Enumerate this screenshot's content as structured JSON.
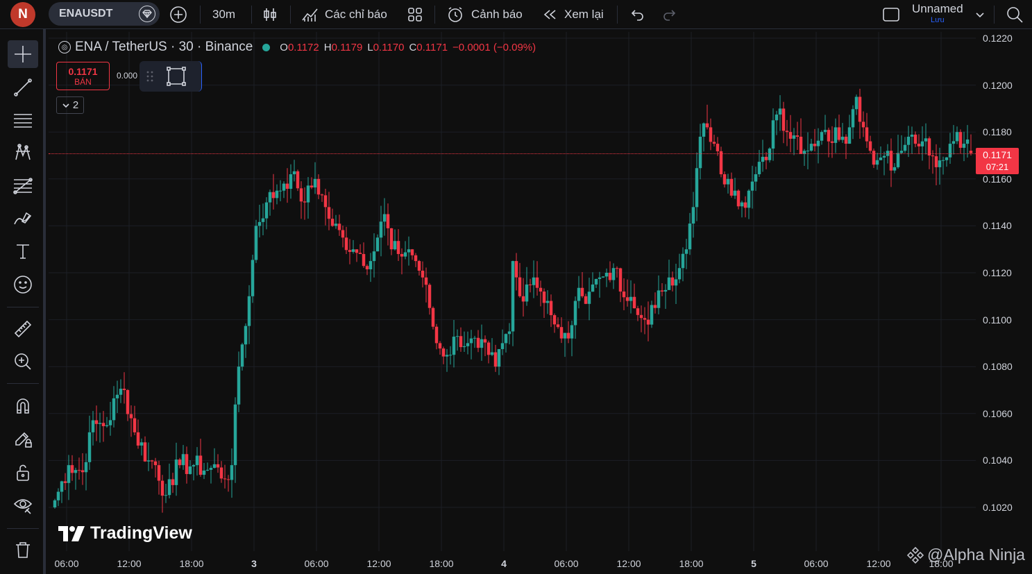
{
  "header": {
    "avatar_letter": "N",
    "symbol": "ENAUSDT",
    "interval": "30m",
    "indicators_label": "Các chỉ báo",
    "alert_label": "Cảnh báo",
    "replay_label": "Xem lại",
    "layout_name": "Unnamed",
    "save_label": "Lưu"
  },
  "legend": {
    "title": "ENA / TetherUS · 30 · Binance",
    "o_key": "O",
    "o_val": "0.1172",
    "h_key": "H",
    "h_val": "0.1179",
    "l_key": "L",
    "l_val": "0.1170",
    "c_key": "C",
    "c_val": "0.1171",
    "change": "−0.0001 (−0.09%)"
  },
  "trade": {
    "sell_price": "0.1171",
    "sell_label": "BÁN",
    "spread": "0.000"
  },
  "collapse": {
    "count": "2"
  },
  "price_tag": {
    "price": "0.1171",
    "countdown": "07:21"
  },
  "branding": {
    "logo_text": "TradingView",
    "watermark": "@Alpha Ninja"
  },
  "colors": {
    "up": "#26a69a",
    "down": "#f23645",
    "background": "#0f0f0f"
  },
  "chart_data": {
    "type": "candlestick",
    "symbol": "ENA / TetherUS",
    "interval": "30",
    "exchange": "Binance",
    "y_ticks": [
      "0.1220",
      "0.1200",
      "0.1180",
      "0.1160",
      "0.1140",
      "0.1120",
      "0.1100",
      "0.1080",
      "0.1060",
      "0.1040",
      "0.1020"
    ],
    "ylim": [
      0.1015,
      0.1222
    ],
    "x_ticks": [
      "06:00",
      "12:00",
      "18:00",
      "3",
      "06:00",
      "12:00",
      "18:00",
      "4",
      "06:00",
      "12:00",
      "18:00",
      "5",
      "06:00",
      "12:00",
      "18:00"
    ],
    "anchors": [
      [
        0,
        0.1023
      ],
      [
        4,
        0.1038
      ],
      [
        8,
        0.1035
      ],
      [
        10,
        0.1052
      ],
      [
        13,
        0.1056
      ],
      [
        15,
        0.1055
      ],
      [
        18,
        0.1068
      ],
      [
        20,
        0.107
      ],
      [
        23,
        0.1052
      ],
      [
        27,
        0.104
      ],
      [
        29,
        0.1038
      ],
      [
        31,
        0.1025
      ],
      [
        33,
        0.1032
      ],
      [
        36,
        0.1038
      ],
      [
        40,
        0.1038
      ],
      [
        44,
        0.1036
      ],
      [
        47,
        0.1037
      ],
      [
        49,
        0.1032
      ],
      [
        51,
        0.1038
      ],
      [
        53,
        0.108
      ],
      [
        56,
        0.111
      ],
      [
        58,
        0.114
      ],
      [
        61,
        0.115
      ],
      [
        64,
        0.1155
      ],
      [
        66,
        0.1158
      ],
      [
        68,
        0.1162
      ],
      [
        70,
        0.1156
      ],
      [
        72,
        0.115
      ],
      [
        75,
        0.116
      ],
      [
        78,
        0.1148
      ],
      [
        80,
        0.114
      ],
      [
        83,
        0.1135
      ],
      [
        86,
        0.113
      ],
      [
        88,
        0.1128
      ],
      [
        91,
        0.1125
      ],
      [
        93,
        0.1135
      ],
      [
        95,
        0.1145
      ],
      [
        97,
        0.113
      ],
      [
        99,
        0.1128
      ],
      [
        102,
        0.113
      ],
      [
        104,
        0.1125
      ],
      [
        106,
        0.1118
      ],
      [
        108,
        0.1105
      ],
      [
        110,
        0.109
      ],
      [
        113,
        0.1085
      ],
      [
        116,
        0.1093
      ],
      [
        119,
        0.109
      ],
      [
        122,
        0.1088
      ],
      [
        125,
        0.1085
      ],
      [
        127,
        0.108
      ],
      [
        129,
        0.109
      ],
      [
        131,
        0.1095
      ],
      [
        132,
        0.1125
      ],
      [
        134,
        0.111
      ],
      [
        136,
        0.1115
      ],
      [
        138,
        0.1118
      ],
      [
        140,
        0.1112
      ],
      [
        142,
        0.1108
      ],
      [
        144,
        0.1098
      ],
      [
        146,
        0.1092
      ],
      [
        148,
        0.1092
      ],
      [
        150,
        0.1108
      ],
      [
        152,
        0.111
      ],
      [
        155,
        0.1115
      ],
      [
        157,
        0.1118
      ],
      [
        159,
        0.112
      ],
      [
        161,
        0.1122
      ],
      [
        163,
        0.1112
      ],
      [
        165,
        0.1108
      ],
      [
        168,
        0.1102
      ],
      [
        170,
        0.11
      ],
      [
        173,
        0.1105
      ],
      [
        175,
        0.1112
      ],
      [
        177,
        0.1118
      ],
      [
        180,
        0.1122
      ],
      [
        182,
        0.113
      ],
      [
        184,
        0.1148
      ],
      [
        186,
        0.1178
      ],
      [
        188,
        0.1182
      ],
      [
        190,
        0.1175
      ],
      [
        192,
        0.1162
      ],
      [
        194,
        0.116
      ],
      [
        196,
        0.1155
      ],
      [
        198,
        0.115
      ],
      [
        200,
        0.1155
      ],
      [
        202,
        0.1162
      ],
      [
        205,
        0.1168
      ],
      [
        207,
        0.1185
      ],
      [
        209,
        0.119
      ],
      [
        211,
        0.118
      ],
      [
        214,
        0.1178
      ],
      [
        216,
        0.1172
      ],
      [
        218,
        0.1175
      ],
      [
        221,
        0.118
      ],
      [
        223,
        0.1176
      ],
      [
        225,
        0.1182
      ],
      [
        227,
        0.1178
      ],
      [
        229,
        0.1182
      ],
      [
        231,
        0.1195
      ],
      [
        233,
        0.1182
      ],
      [
        235,
        0.1172
      ],
      [
        237,
        0.1168
      ],
      [
        240,
        0.1172
      ],
      [
        242,
        0.1165
      ],
      [
        244,
        0.1172
      ],
      [
        246,
        0.1178
      ],
      [
        248,
        0.1175
      ],
      [
        250,
        0.1176
      ],
      [
        252,
        0.117
      ],
      [
        254,
        0.1165
      ],
      [
        256,
        0.1168
      ],
      [
        258,
        0.1175
      ],
      [
        260,
        0.118
      ],
      [
        262,
        0.1175
      ],
      [
        264,
        0.1171
      ]
    ],
    "last": {
      "open": 0.1172,
      "high": 0.1179,
      "low": 0.117,
      "close": 0.1171
    }
  }
}
